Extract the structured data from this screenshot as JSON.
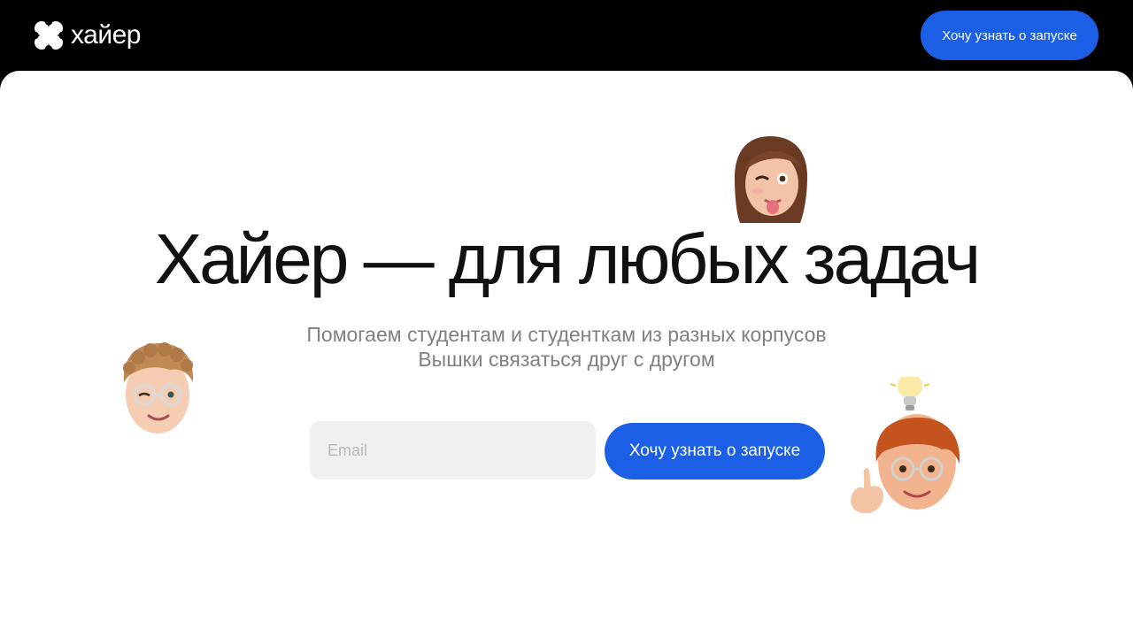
{
  "header": {
    "logo_text": "хайер",
    "logo_icon": "clover-icon",
    "cta_label": "Хочу узнать о запуске"
  },
  "hero": {
    "title": "Хайер — для любых задач",
    "subtitle": "Помогаем студентам и студенткам из разных корпусов Вышки связаться друг с другом",
    "email_placeholder": "Email",
    "email_value": "",
    "cta_label": "Хочу узнать о запуске"
  },
  "decorations": [
    "winking-girl-memoji",
    "curly-boy-glasses-memoji",
    "redhead-idea-memoji"
  ],
  "colors": {
    "accent": "#1a5fe6",
    "header_bg": "#000000",
    "page_bg": "#ffffff",
    "input_bg": "#f0f0f0",
    "title": "#111111",
    "subtitle": "#808080"
  }
}
